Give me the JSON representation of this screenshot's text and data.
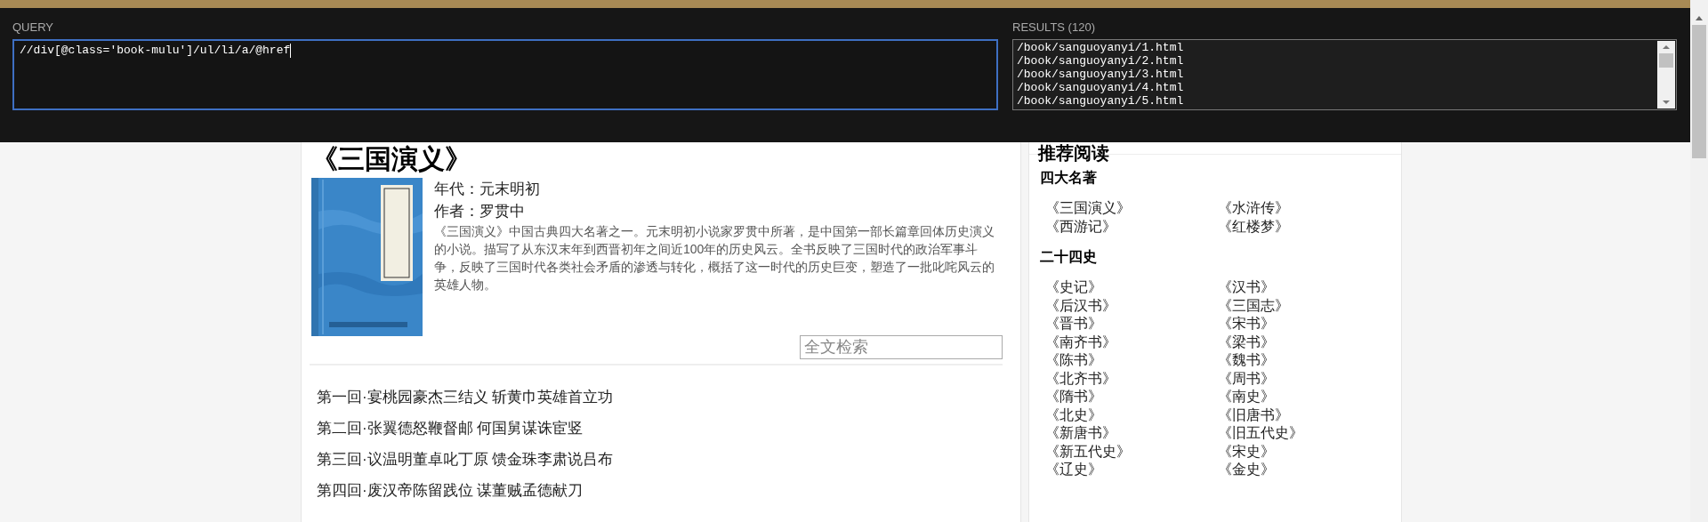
{
  "book": {
    "title": "《三国演义》",
    "cover": {
      "kind": "picture"
    },
    "meta": [
      "年代：元末明初",
      "作者：罗贯中"
    ],
    "description": "《三国演义》中国古典四大名著之一。元末明初小说家罗贯中所著，是中国第一部长篇章回体历史演义的小说。描写了从东汉末年到西晋初年之间近100年的历史风云。全书反映了三国时代的政治军事斗争，反映了三国时代各类社会矛盾的渗透与转化，概括了这一时代的历史巨变，塑造了一批叱咤风云的英雄人物。",
    "search": {
      "placeholder": "全文检索"
    },
    "chapters": [
      "第一回·宴桃园豪杰三结义 斩黄巾英雄首立功",
      "第二回·张翼德怒鞭督邮 何国舅谋诛宦竖",
      "第三回·议温明董卓叱丁原 馈金珠李肃说吕布",
      "第四回·废汉帝陈留践位 谋董贼孟德献刀"
    ]
  },
  "sidebar": {
    "title": "推荐阅读",
    "sections": [
      {
        "heading": "四大名著",
        "items": [
          "《三国演义》",
          "《水浒传》",
          "《西游记》",
          "《红楼梦》"
        ]
      },
      {
        "heading": "二十四史",
        "items": [
          "《史记》",
          "《汉书》",
          "《后汉书》",
          "《三国志》",
          "《晋书》",
          "《宋书》",
          "《南齐书》",
          "《梁书》",
          "《陈书》",
          "《魏书》",
          "《北齐书》",
          "《周书》",
          "《隋书》",
          "《南史》",
          "《北史》",
          "《旧唐书》",
          "《新唐书》",
          "《旧五代史》",
          "《新五代史》",
          "《宋史》",
          "《辽史》",
          "《金史》"
        ]
      }
    ]
  },
  "xpath_helper": {
    "query_label": "QUERY",
    "query": "//div[@class='book-mulu']/ul/li/a/@href",
    "results_label": "RESULTS (120)",
    "results": [
      "/book/sanguoyanyi/1.html",
      "/book/sanguoyanyi/2.html",
      "/book/sanguoyanyi/3.html",
      "/book/sanguoyanyi/4.html",
      "/book/sanguoyanyi/5.html"
    ]
  }
}
